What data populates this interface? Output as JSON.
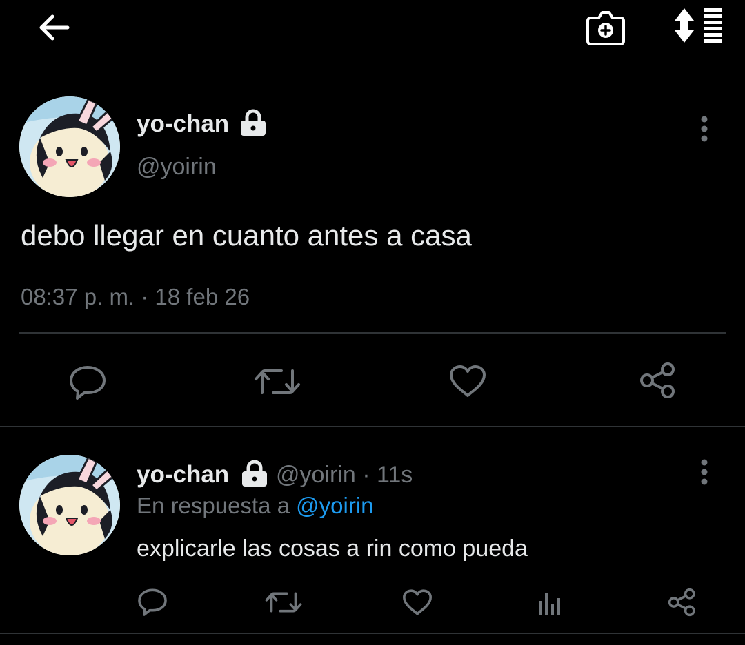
{
  "header": {
    "back_icon": "arrow-left-icon",
    "camera_icon": "camera-add-icon",
    "sort_icon": "sort-list-icon"
  },
  "main_tweet": {
    "display_name": "yo-chan",
    "protected_icon": "lock-icon",
    "handle": "@yoirin",
    "text": "debo llegar en cuanto antes a casa",
    "timestamp": "08:37 p. m. · 18 feb 26",
    "actions": [
      "reply-icon",
      "retweet-icon",
      "like-icon",
      "share-icon"
    ]
  },
  "reply_tweet": {
    "display_name": "yo-chan",
    "handle_time": "@yoirin · 11s",
    "reply_prefix": "En respuesta a ",
    "reply_mention": "@yoirin",
    "text": "explicarle las cosas a rin como pueda",
    "actions": [
      "reply-icon",
      "retweet-icon",
      "like-icon",
      "analytics-icon",
      "share-icon"
    ]
  },
  "colors": {
    "background": "#000000",
    "text": "#e7e9ea",
    "muted": "#71767b",
    "accent": "#1d9bf0",
    "divider": "#2f3336"
  }
}
